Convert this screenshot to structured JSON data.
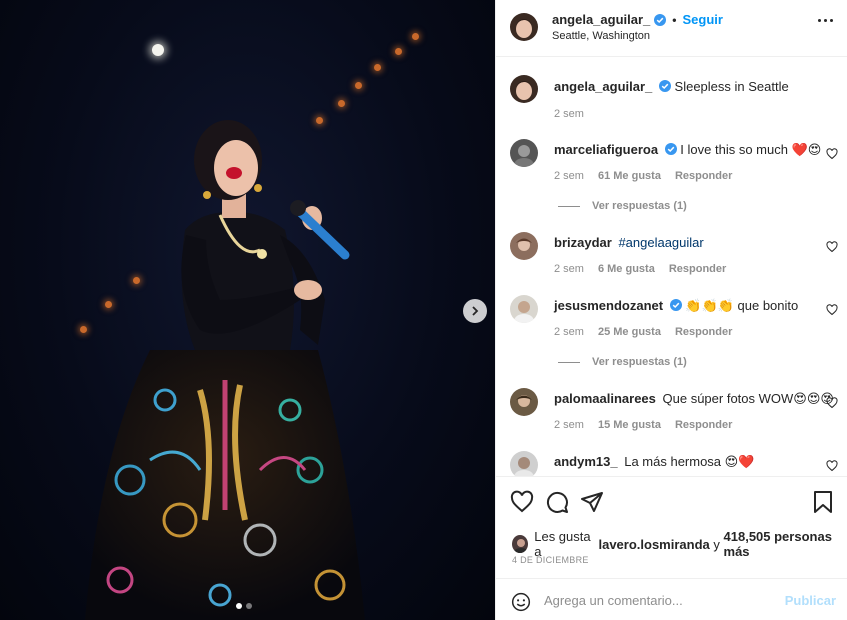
{
  "post": {
    "user": "angela_aguilar_",
    "follow_label": "Seguir",
    "location": "Seattle, Washington",
    "caption": "Sleepless in Seattle",
    "caption_time": "2 sem",
    "carousel": {
      "count": 2,
      "active": 1
    }
  },
  "comments": [
    {
      "user": "marceliafigueroa",
      "verified": true,
      "text": "I love this so much ❤️😍",
      "time": "2 sem",
      "likes": "61 Me gusta",
      "reply_label": "Responder",
      "view_replies": "Ver respuestas (1)"
    },
    {
      "user": "brizaydar",
      "verified": false,
      "text": "#angelaaguilar",
      "time": "2 sem",
      "likes": "6 Me gusta",
      "reply_label": "Responder"
    },
    {
      "user": "jesusmendozanet",
      "verified": true,
      "text": "👏👏👏 que bonito",
      "time": "2 sem",
      "likes": "25 Me gusta",
      "reply_label": "Responder",
      "view_replies": "Ver respuestas (1)"
    },
    {
      "user": "palomaalinarees",
      "verified": false,
      "text": "Que súper fotos WOW😍😍😍",
      "time": "2 sem",
      "likes": "15 Me gusta",
      "reply_label": "Responder"
    },
    {
      "user": "andym13_",
      "verified": false,
      "text": "La más hermosa 😍❤️"
    }
  ],
  "likes": {
    "prefix": "Les gusta a",
    "user": "lavero.losmiranda",
    "joiner": "y",
    "count": "418,505 personas más"
  },
  "date": "4 DE DICIEMBRE",
  "comment_box": {
    "placeholder": "Agrega un comentario...",
    "post_label": "Publicar"
  },
  "colors": {
    "accent": "#0095f6",
    "verified": "#3897f0",
    "heart_red": "#c8102e"
  },
  "icons": [
    "verified-icon",
    "more-icon",
    "heart-icon",
    "comment-icon",
    "share-icon",
    "bookmark-icon",
    "smile-icon",
    "chevron-right-icon"
  ]
}
